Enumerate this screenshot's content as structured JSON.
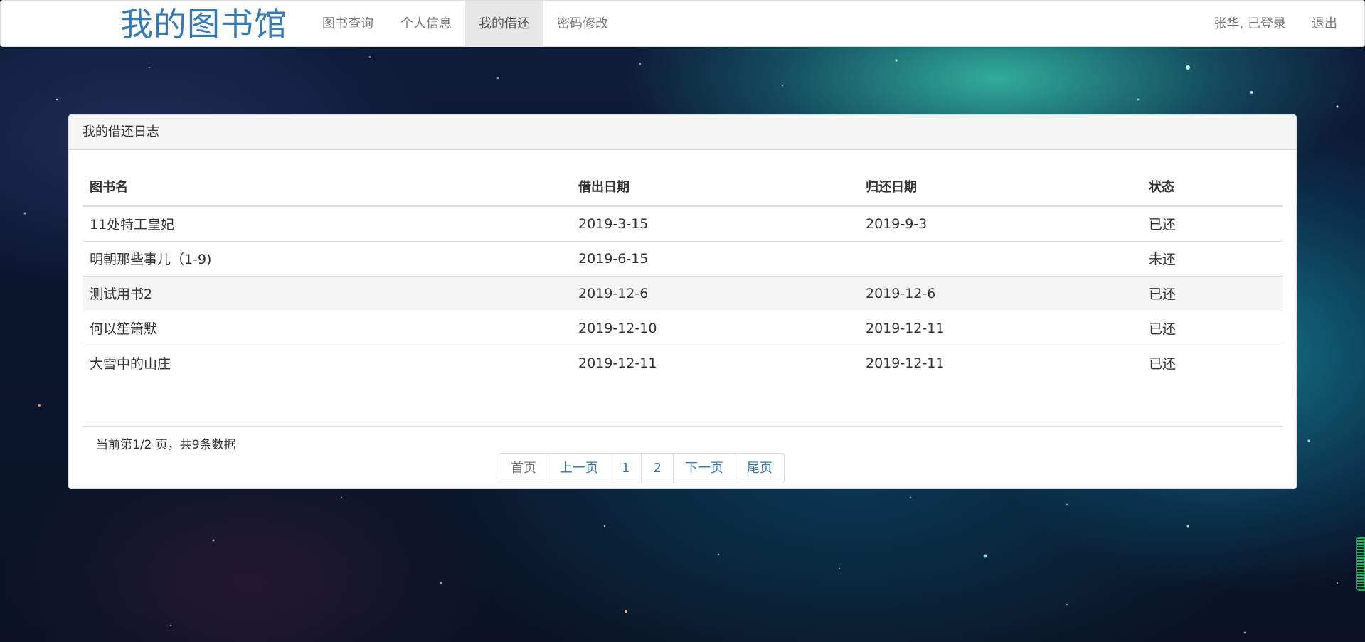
{
  "navbar": {
    "brand": "我的图书馆",
    "links": [
      "图书查询",
      "个人信息",
      "我的借还",
      "密码修改"
    ],
    "user_status": "张华, 已登录",
    "logout": "退出"
  },
  "panel": {
    "title": "我的借还日志",
    "headers": [
      "图书名",
      "借出日期",
      "归还日期",
      "状态"
    ],
    "rows": [
      [
        "11处特工皇妃",
        "2019-3-15",
        "2019-9-3",
        "已还"
      ],
      [
        "明朝那些事儿（1-9)",
        "2019-6-15",
        "",
        "未还"
      ],
      [
        "测试用书2",
        "2019-12-6",
        "2019-12-6",
        "已还"
      ],
      [
        "何以笙箫默",
        "2019-12-10",
        "2019-12-11",
        "已还"
      ],
      [
        "大雪中的山庄",
        "2019-12-11",
        "2019-12-11",
        "已还"
      ]
    ],
    "page_info": "当前第1/2 页，共9条数据",
    "pagination": [
      "首页",
      "上一页",
      "1",
      "2",
      "下一页",
      "尾页"
    ]
  },
  "colors": {
    "brand": "#337ab7",
    "active_nav_bg": "#e7e7e7",
    "link": "#337ab7"
  }
}
